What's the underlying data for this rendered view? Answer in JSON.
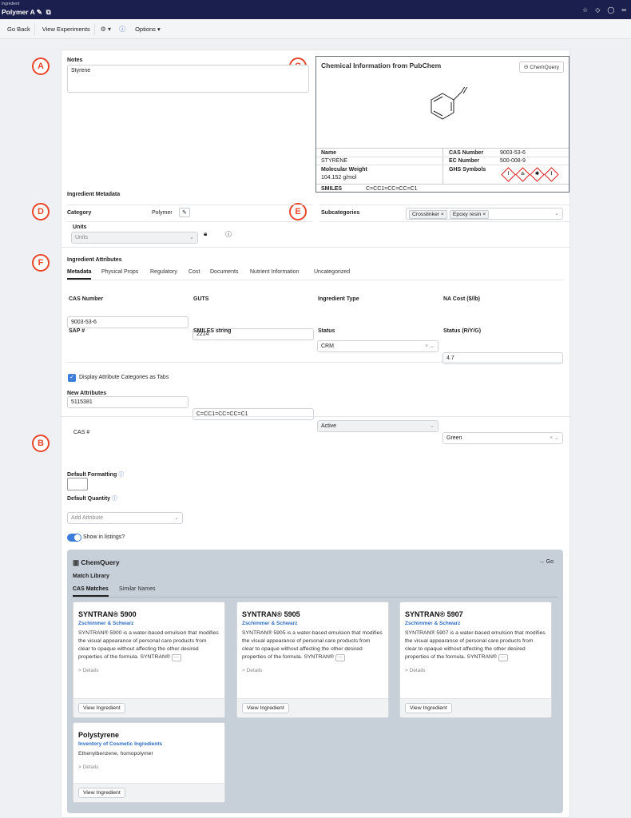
{
  "topbar": {
    "subtitle": "Ingredient",
    "title": "Polymer A"
  },
  "toolbar": {
    "go_back": "Go Back",
    "view_experiments": "View Experiments",
    "options": "Options"
  },
  "annotations": {
    "a": "A",
    "b": "B",
    "c": "C",
    "d": "D",
    "e": "E",
    "f": "F"
  },
  "notes": {
    "label": "Notes",
    "value": "Styrene"
  },
  "pubchem": {
    "title": "Chemical Information from PubChem",
    "button": "ChemQuery",
    "name_label": "Name",
    "name_value": "STYRENE",
    "cas_label": "CAS Number",
    "cas_value": "9003-53-6",
    "ec_label": "EC Number",
    "ec_value": "500-008-9",
    "mw_label": "Molecular Weight",
    "mw_value": "104.152 g/mol",
    "ghs_label": "GHS Symbols",
    "smiles_label": "SMILES",
    "smiles_value": "C=CC1=CC=CC=C1"
  },
  "metadata": {
    "heading": "Ingredient Metadata",
    "category_label": "Category",
    "category_value": "Polymer",
    "subcategories_label": "Subcategories",
    "subcategories": [
      "Crosslinker",
      "Epoxy resin"
    ],
    "units_label": "Units",
    "units_placeholder": "Units"
  },
  "attributes": {
    "heading": "Ingredient Attributes",
    "tabs": [
      "Metadata",
      "Physical Props",
      "Regulatory",
      "Cost",
      "Documents",
      "Nutrient Information",
      "Uncategorized"
    ],
    "fields": {
      "cas_label": "CAS Number",
      "cas_value": "9003-53-6",
      "guts_label": "GUTS",
      "guts_value": "2214",
      "type_label": "Ingredient Type",
      "type_value": "CRM",
      "na_label": "NA Cost ($/lb)",
      "na_value": "4.7",
      "sap_label": "SAP #",
      "sap_value": "5115381",
      "smiles_label": "SMILES string",
      "smiles_value": "C=CC1=CC=CC=C1",
      "status_label": "Status",
      "status_value": "Active",
      "ryg_label": "Status (R/Y/G)",
      "ryg_value": "Green"
    },
    "display_tabs": "Display Attribute Categories as Tabs",
    "new_attributes": "New Attributes",
    "add_attribute": "Add Attribute"
  },
  "cas_hash_label": "CAS #",
  "default_formatting": "Default Formatting",
  "default_quantity": "Default Quantity",
  "show_in_listings": "Show in listings?",
  "chemquery": {
    "title": "ChemQuery",
    "go": "Go",
    "match_library": "Match Library",
    "tabs": [
      "CAS Matches",
      "Similar Names"
    ],
    "cards": [
      {
        "title": "SYNTRAN® 5900",
        "source": "Zschimmer & Schwarz",
        "desc": "SYNTRAN® 5900 is a water-based emulsion that modifies the visual appearance of personal care products from clear to opaque without affecting the other desired properties of the formula. SYNTRAN®",
        "details": "Details",
        "button": "View Ingredient"
      },
      {
        "title": "SYNTRAN® 5905",
        "source": "Zschimmer & Schwarz",
        "desc": "SYNTRAN® 5905 is a water-based emulsion that modifies the visual appearance of personal care products from clear to opaque without affecting the other desired properties of the formula. SYNTRAN®",
        "details": "Details",
        "button": "View Ingredient"
      },
      {
        "title": "SYNTRAN® 5907",
        "source": "Zschimmer & Schwarz",
        "desc": "SYNTRAN® 5907 is a water-based emulsion that modifies the visual appearance of personal care products from clear to opaque without affecting the other desired properties of the formula. SYNTRAN®",
        "details": "Details",
        "button": "View Ingredient"
      },
      {
        "title": "Polystyrene",
        "source": "Inventory of Cosmetic Ingredients",
        "desc": "Ethenylbenzene, homopolymer",
        "details": "Details",
        "button": "View Ingredient"
      }
    ]
  }
}
